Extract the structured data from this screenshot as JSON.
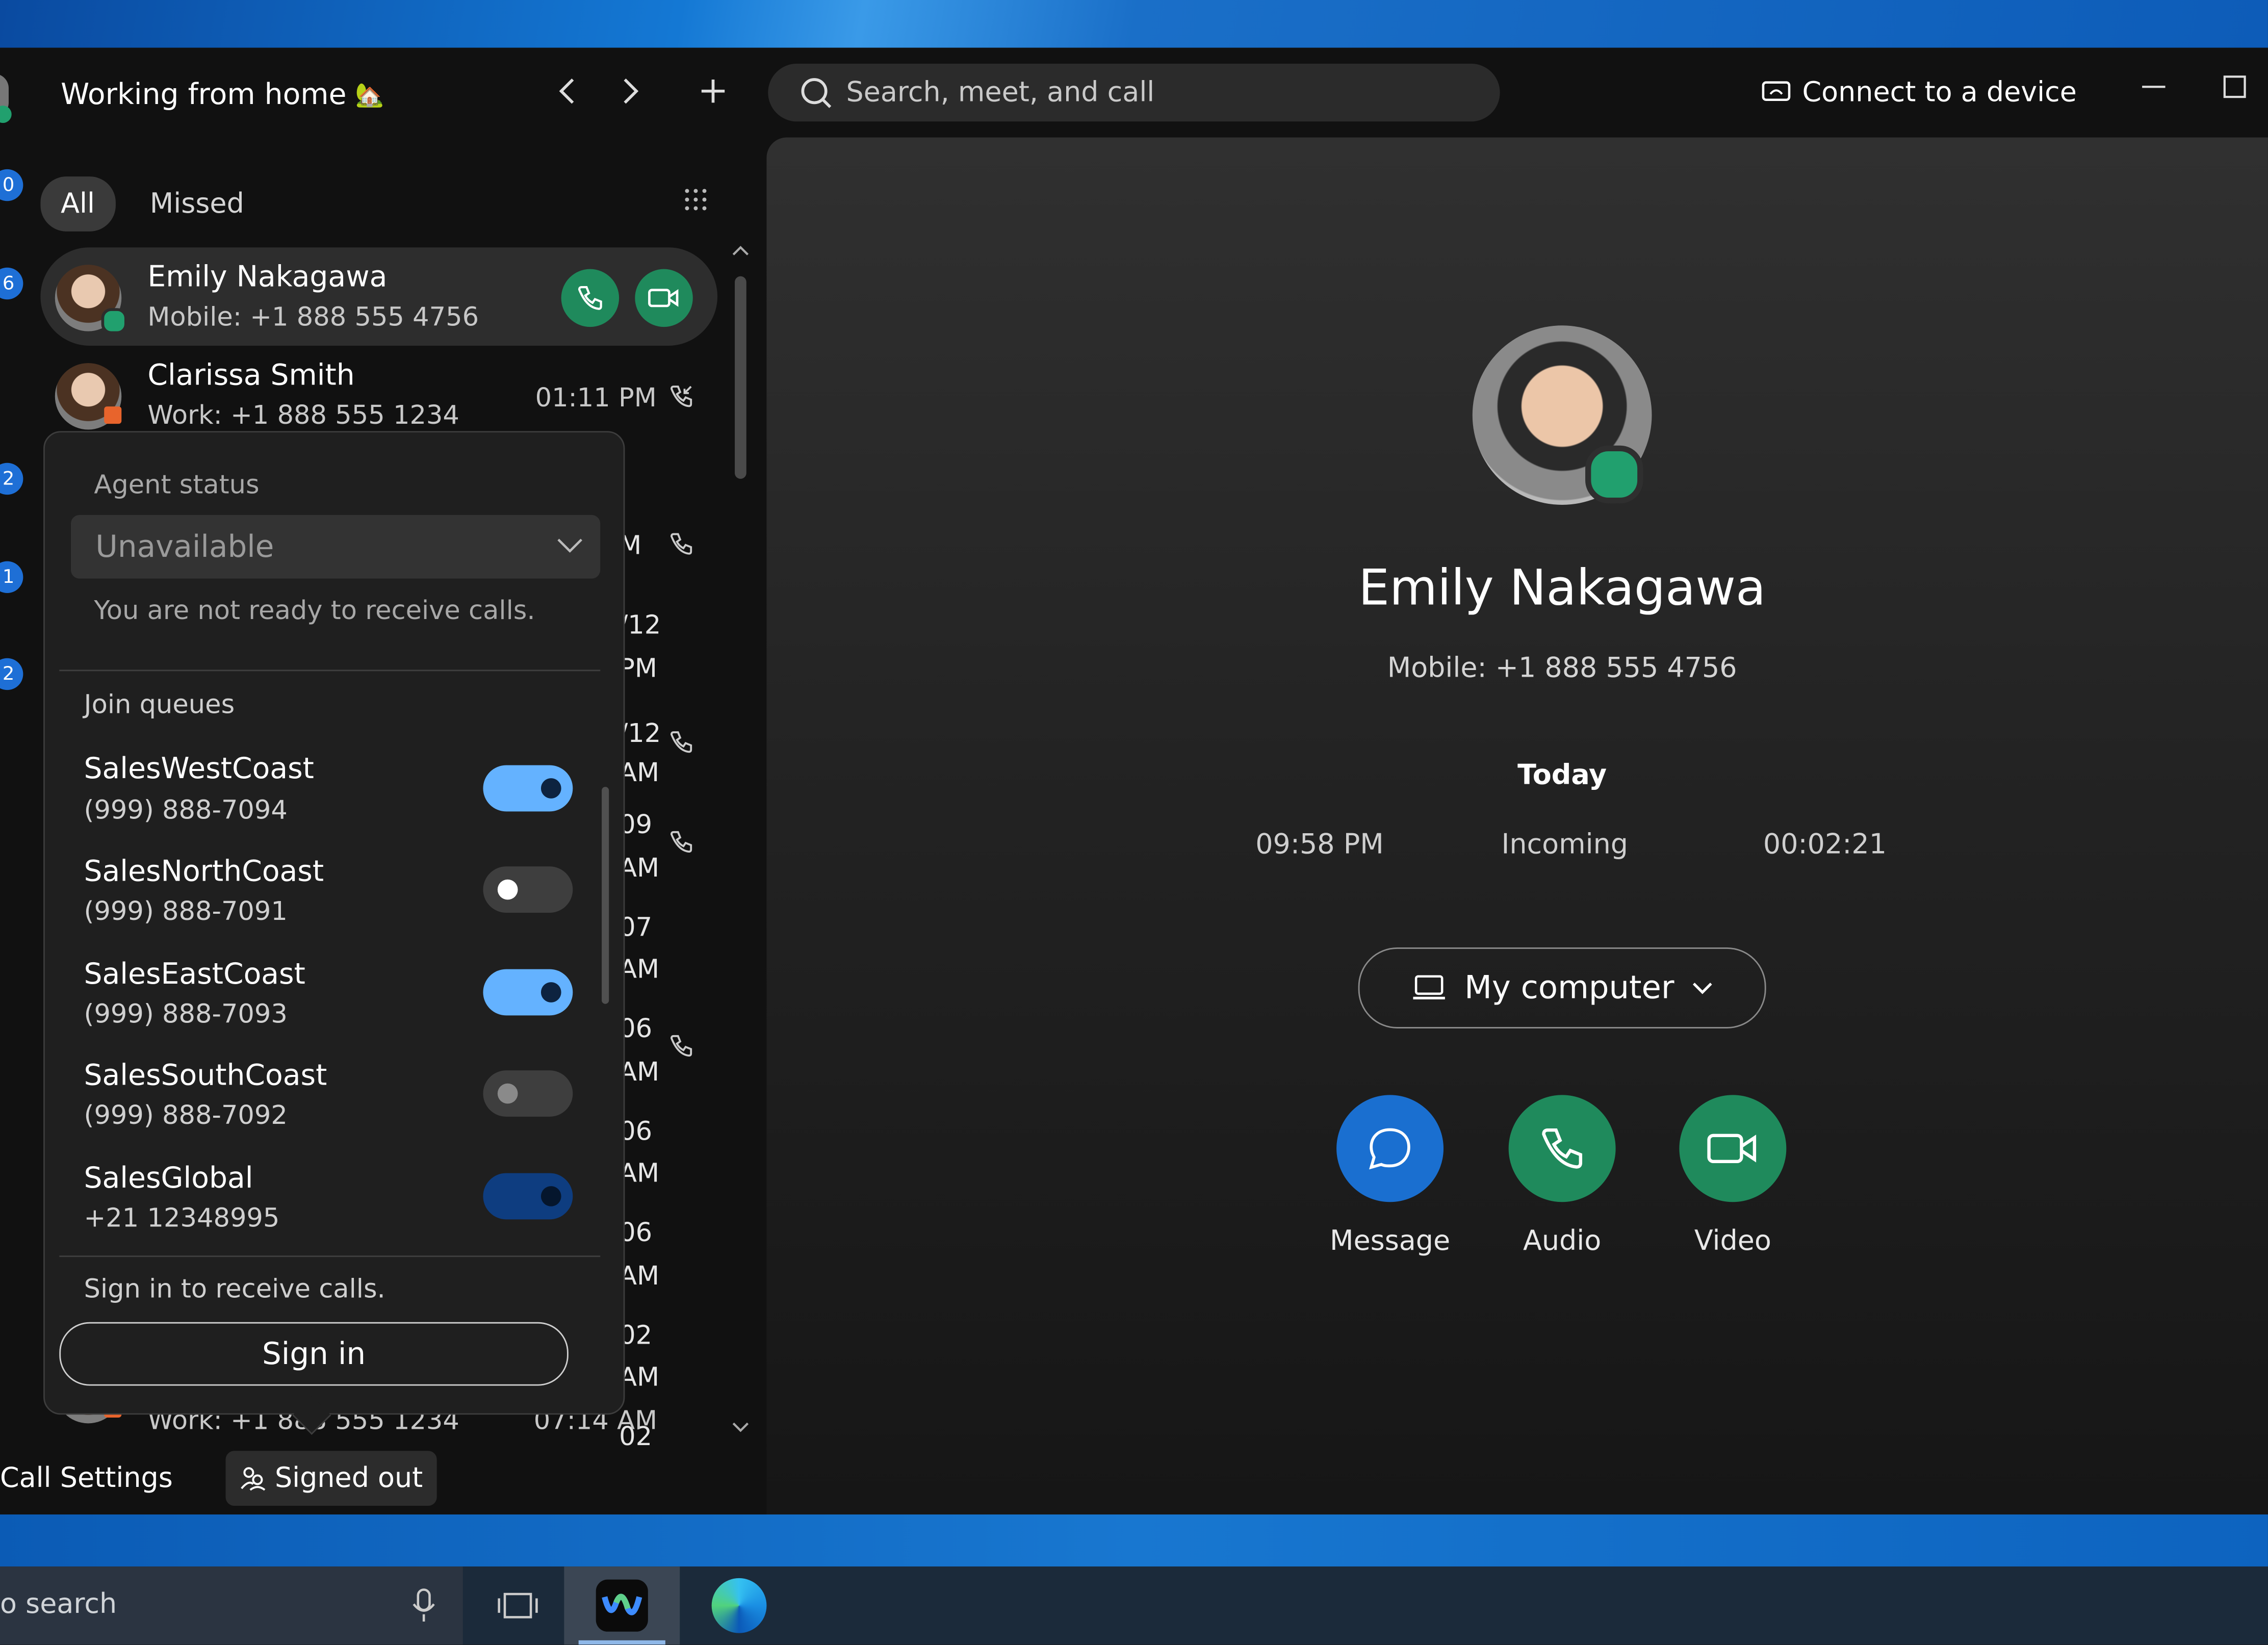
{
  "window": {
    "title": "Working from home",
    "title_emoji": "🏡",
    "search_placeholder": "Search, meet, and call",
    "connect_label": "Connect to a device"
  },
  "left_rail": {
    "badges": [
      "0",
      "6",
      "2",
      "1",
      "2"
    ]
  },
  "tabs": {
    "all": "All",
    "missed": "Missed"
  },
  "calls": [
    {
      "name": "Emily Nakagawa",
      "sub": "Mobile: +1 888 555 4756",
      "time": ""
    },
    {
      "name": "Clarissa Smith",
      "sub": "Work: +1 888 555 1234",
      "time": "01:11 PM"
    },
    {
      "name": "",
      "sub": "Work: +1 888 555 1234",
      "time": "07:14 AM"
    }
  ],
  "obscured_times": [
    "M",
    "/12",
    "PM",
    "/12",
    "AM",
    "09",
    "AM",
    "07",
    "AM",
    "06",
    "AM",
    "06",
    "AM",
    "06",
    "AM",
    "02",
    "AM",
    "02"
  ],
  "agent_popup": {
    "status_label": "Agent status",
    "status_value": "Unavailable",
    "status_hint": "You are not ready to receive calls.",
    "join_label": "Join queues",
    "queues": [
      {
        "name": "SalesWestCoast",
        "number": "(999) 888-7094",
        "enabled": true
      },
      {
        "name": "SalesNorthCoast",
        "number": "(999) 888-7091",
        "enabled": false
      },
      {
        "name": "SalesEastCoast",
        "number": "(999) 888-7093",
        "enabled": true
      },
      {
        "name": "SalesSouthCoast",
        "number": "(999) 888-7092",
        "enabled": false
      },
      {
        "name": "SalesGlobal",
        "number": "+21 12348995",
        "enabled": true
      }
    ],
    "sign_in_hint": "Sign in to receive calls.",
    "sign_in_button": "Sign in"
  },
  "footer": {
    "call_settings": "Call Settings",
    "signed_out": "Signed out"
  },
  "contact": {
    "name": "Emily Nakagawa",
    "mobile": "Mobile: +1 888 555 4756",
    "history_heading": "Today",
    "history": {
      "time": "09:58 PM",
      "direction": "Incoming",
      "duration": "00:02:21"
    },
    "device": "My computer",
    "actions": {
      "message": "Message",
      "audio": "Audio",
      "video": "Video"
    }
  },
  "taskbar": {
    "search_text": "o search"
  },
  "colors": {
    "accent_green": "#1f8a5c",
    "message_blue": "#1a6fd0",
    "toggle_on": "#64b2ff",
    "presence": "#21a06e"
  }
}
